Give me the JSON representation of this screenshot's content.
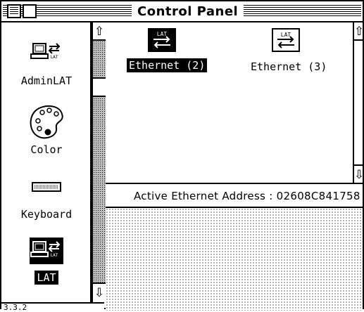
{
  "window": {
    "title": "Control Panel"
  },
  "sidebar": {
    "items": [
      {
        "label": "AdminLAT",
        "icon": "adminlat-icon"
      },
      {
        "label": "Color",
        "icon": "palette-icon"
      },
      {
        "label": "Keyboard",
        "icon": "keyboard-icon"
      },
      {
        "label": "LAT",
        "icon": "lat-icon",
        "selected": true
      }
    ],
    "version": "3.3.2"
  },
  "devices": [
    {
      "label": "Ethernet (2)",
      "icon": "lat-ethernet-icon",
      "selected": true
    },
    {
      "label": "Ethernet (3)",
      "icon": "lat-ethernet-icon",
      "selected": false
    }
  ],
  "status": {
    "text": "Active Ethernet Address : 02608C841758"
  },
  "icon_badge": "LAT"
}
